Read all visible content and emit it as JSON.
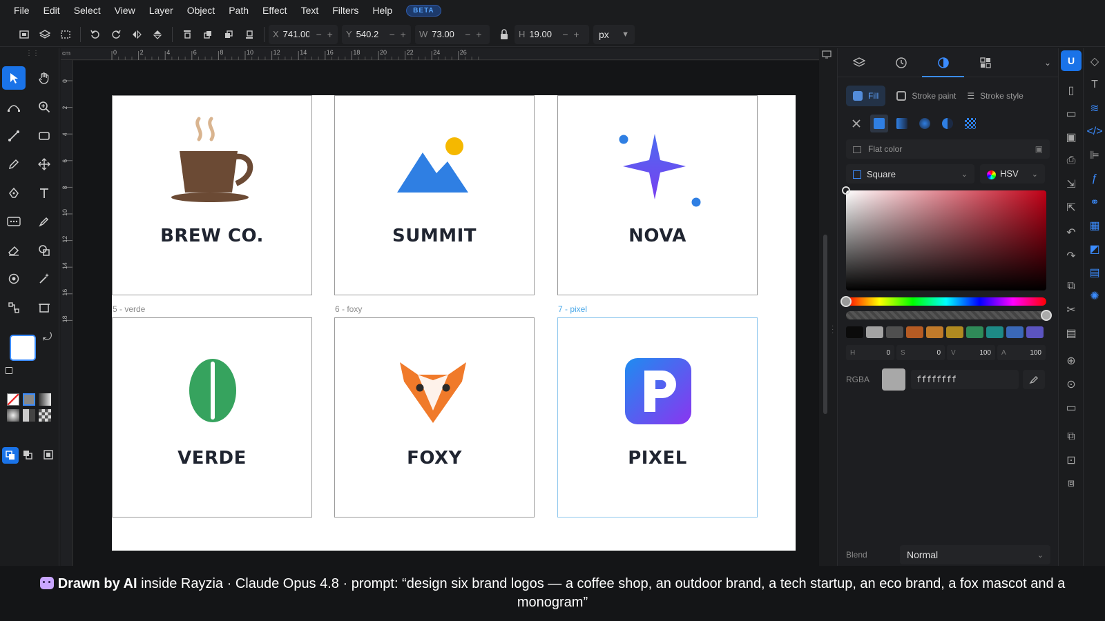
{
  "menu": [
    "File",
    "Edit",
    "Select",
    "View",
    "Layer",
    "Object",
    "Path",
    "Effect",
    "Text",
    "Filters",
    "Help"
  ],
  "beta_badge": "BETA",
  "toolbar": {
    "x_label": "X",
    "x_value": "741.00",
    "y_label": "Y",
    "y_value": "540.2",
    "w_label": "W",
    "w_value": "73.00",
    "h_label": "H",
    "h_value": "19.00",
    "unit": "px"
  },
  "ruler_unit": "cm",
  "ruler_top_ticks": [
    "0",
    "2",
    "4",
    "6",
    "8",
    "10",
    "12",
    "14",
    "16",
    "18",
    "20",
    "22",
    "24",
    "26"
  ],
  "ruler_left_ticks": [
    "0",
    "2",
    "4",
    "6",
    "8",
    "10",
    "12",
    "14",
    "16",
    "18"
  ],
  "cards": [
    {
      "title": "BREW CO.",
      "label": "",
      "icon": "coffee-cup-logo"
    },
    {
      "title": "SUMMIT",
      "label": "",
      "icon": "mountain-sun-logo"
    },
    {
      "title": "NOVA",
      "label": "",
      "icon": "star-sparkle-logo"
    },
    {
      "title": "VERDE",
      "label": "5 - verde",
      "icon": "leaf-bean-logo"
    },
    {
      "title": "FOXY",
      "label": "6 - foxy",
      "icon": "fox-head-logo"
    },
    {
      "title": "PIXEL",
      "label": "7 - pixel",
      "icon": "p-monogram-logo",
      "selected": true
    }
  ],
  "panel": {
    "fill_tab": "Fill",
    "stroke_paint_tab": "Stroke paint",
    "stroke_style_tab": "Stroke style",
    "flat_color": "Flat color",
    "mode": "Square",
    "colorspace": "HSV",
    "hsva": [
      {
        "k": "H",
        "v": "0"
      },
      {
        "k": "S",
        "v": "0"
      },
      {
        "k": "V",
        "v": "100"
      },
      {
        "k": "A",
        "v": "100"
      }
    ],
    "rgba_label": "RGBA",
    "rgba_value": "ffffffff",
    "blend_label": "Blend",
    "blend_value": "Normal",
    "swatches": [
      "#0b0b0b",
      "#a3a3a3",
      "#4f4f4f",
      "#b55b23",
      "#c07a2a",
      "#b08a20",
      "#2f8a58",
      "#1d8a86",
      "#3a68b8",
      "#5b54c0"
    ]
  },
  "banner": {
    "bold": "Drawn by AI",
    "text": " inside Rayzia · Claude Opus 4.8 · prompt: “design six brand logos — a coffee shop, an outdoor brand, a tech startup, an eco brand, a fox mascot and a monogram”"
  },
  "colors": {
    "accent": "#1a73e8",
    "canvas_bg": "#141517",
    "panel_bg": "#1d1e21"
  }
}
